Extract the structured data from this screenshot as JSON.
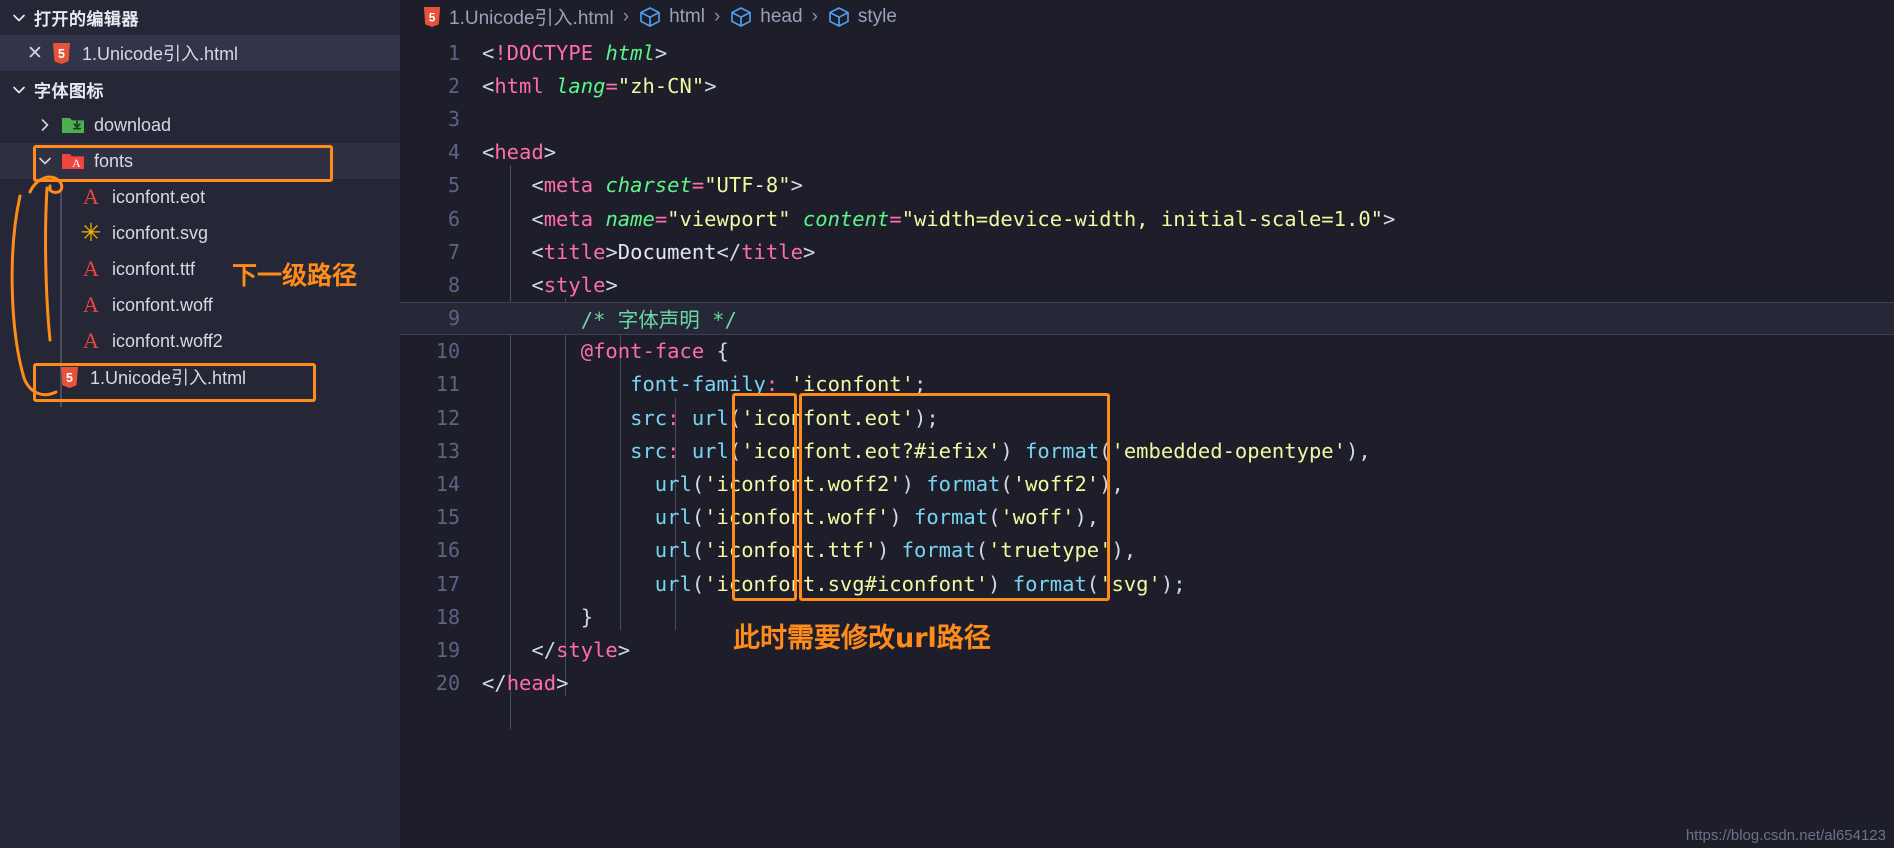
{
  "sidebar": {
    "sections": [
      {
        "name": "open-editors",
        "title": "打开的编辑器",
        "expanded_icon": "chevron-down-icon"
      },
      {
        "name": "font-icon-project",
        "title": "字体图标",
        "expanded_icon": "chevron-down-icon"
      }
    ],
    "open_editors": [
      {
        "label": "1.Unicode引入.html",
        "icon": "html5-icon",
        "close_icon": "close-icon",
        "active": true
      }
    ],
    "tree": [
      {
        "label": "download",
        "icon": "folder-download-icon",
        "type": "folder",
        "expanded": false,
        "chevron": "chevron-right-icon",
        "depth": 1
      },
      {
        "label": "fonts",
        "icon": "folder-font-icon",
        "type": "folder",
        "expanded": true,
        "chevron": "chevron-down-icon",
        "depth": 1,
        "selected": true,
        "highlighted": true
      },
      {
        "label": "iconfont.eot",
        "icon": "font-file-icon",
        "type": "file",
        "depth": 2
      },
      {
        "label": "iconfont.svg",
        "icon": "svg-file-icon",
        "type": "file",
        "depth": 2
      },
      {
        "label": "iconfont.ttf",
        "icon": "font-file-icon",
        "type": "file",
        "depth": 2
      },
      {
        "label": "iconfont.woff",
        "icon": "font-file-icon",
        "type": "file",
        "depth": 2
      },
      {
        "label": "iconfont.woff2",
        "icon": "font-file-icon",
        "type": "file",
        "depth": 2
      },
      {
        "label": "1.Unicode引入.html",
        "icon": "html5-icon",
        "type": "file",
        "depth": 1,
        "highlighted": true
      }
    ]
  },
  "breadcrumb": {
    "items": [
      {
        "label": "1.Unicode引入.html",
        "icon": "html5-icon"
      },
      {
        "label": "html",
        "icon": "symbol-cube-icon"
      },
      {
        "label": "head",
        "icon": "symbol-cube-icon"
      },
      {
        "label": "style",
        "icon": "symbol-cube-icon"
      }
    ],
    "separator": "›"
  },
  "editor": {
    "current_line": 9,
    "lines": [
      {
        "n": 1,
        "text": "<!DOCTYPE html>"
      },
      {
        "n": 2,
        "text": "<html lang=\"zh-CN\">"
      },
      {
        "n": 3,
        "text": ""
      },
      {
        "n": 4,
        "text": "<head>"
      },
      {
        "n": 5,
        "text": "    <meta charset=\"UTF-8\">"
      },
      {
        "n": 6,
        "text": "    <meta name=\"viewport\" content=\"width=device-width, initial-scale=1.0\">"
      },
      {
        "n": 7,
        "text": "    <title>Document</title>"
      },
      {
        "n": 8,
        "text": "    <style>"
      },
      {
        "n": 9,
        "text": "        /* 字体声明 */"
      },
      {
        "n": 10,
        "text": "        @font-face {"
      },
      {
        "n": 11,
        "text": "            font-family: 'iconfont';"
      },
      {
        "n": 12,
        "text": "            src: url('iconfont.eot');"
      },
      {
        "n": 13,
        "text": "            src: url('iconfont.eot?#iefix') format('embedded-opentype'),"
      },
      {
        "n": 14,
        "text": "              url('iconfont.woff2') format('woff2'),"
      },
      {
        "n": 15,
        "text": "              url('iconfont.woff') format('woff'),"
      },
      {
        "n": 16,
        "text": "              url('iconfont.ttf') format('truetype'),"
      },
      {
        "n": 17,
        "text": "              url('iconfont.svg#iconfont') format('svg');"
      },
      {
        "n": 18,
        "text": "        }"
      },
      {
        "n": 19,
        "text": "    </style>"
      },
      {
        "n": 20,
        "text": "</head>"
      }
    ]
  },
  "annotations": {
    "accent_color": "#ff8c1a",
    "note_path_level": "下一级路径",
    "note_modify_url": "此时需要修改url路径"
  },
  "watermark": "https://blog.csdn.net/al654123",
  "colors": {
    "sidebar_bg": "#252636",
    "editor_bg": "#1e1e2a",
    "selected_row": "#2f3142",
    "accent_orange": "#ff8c1a",
    "html5_icon": "#e8513a",
    "font_file_red": "#f0443e",
    "svg_star_yellow": "#f5b300",
    "folder_green": "#4caf50",
    "folder_red": "#f0443e"
  }
}
